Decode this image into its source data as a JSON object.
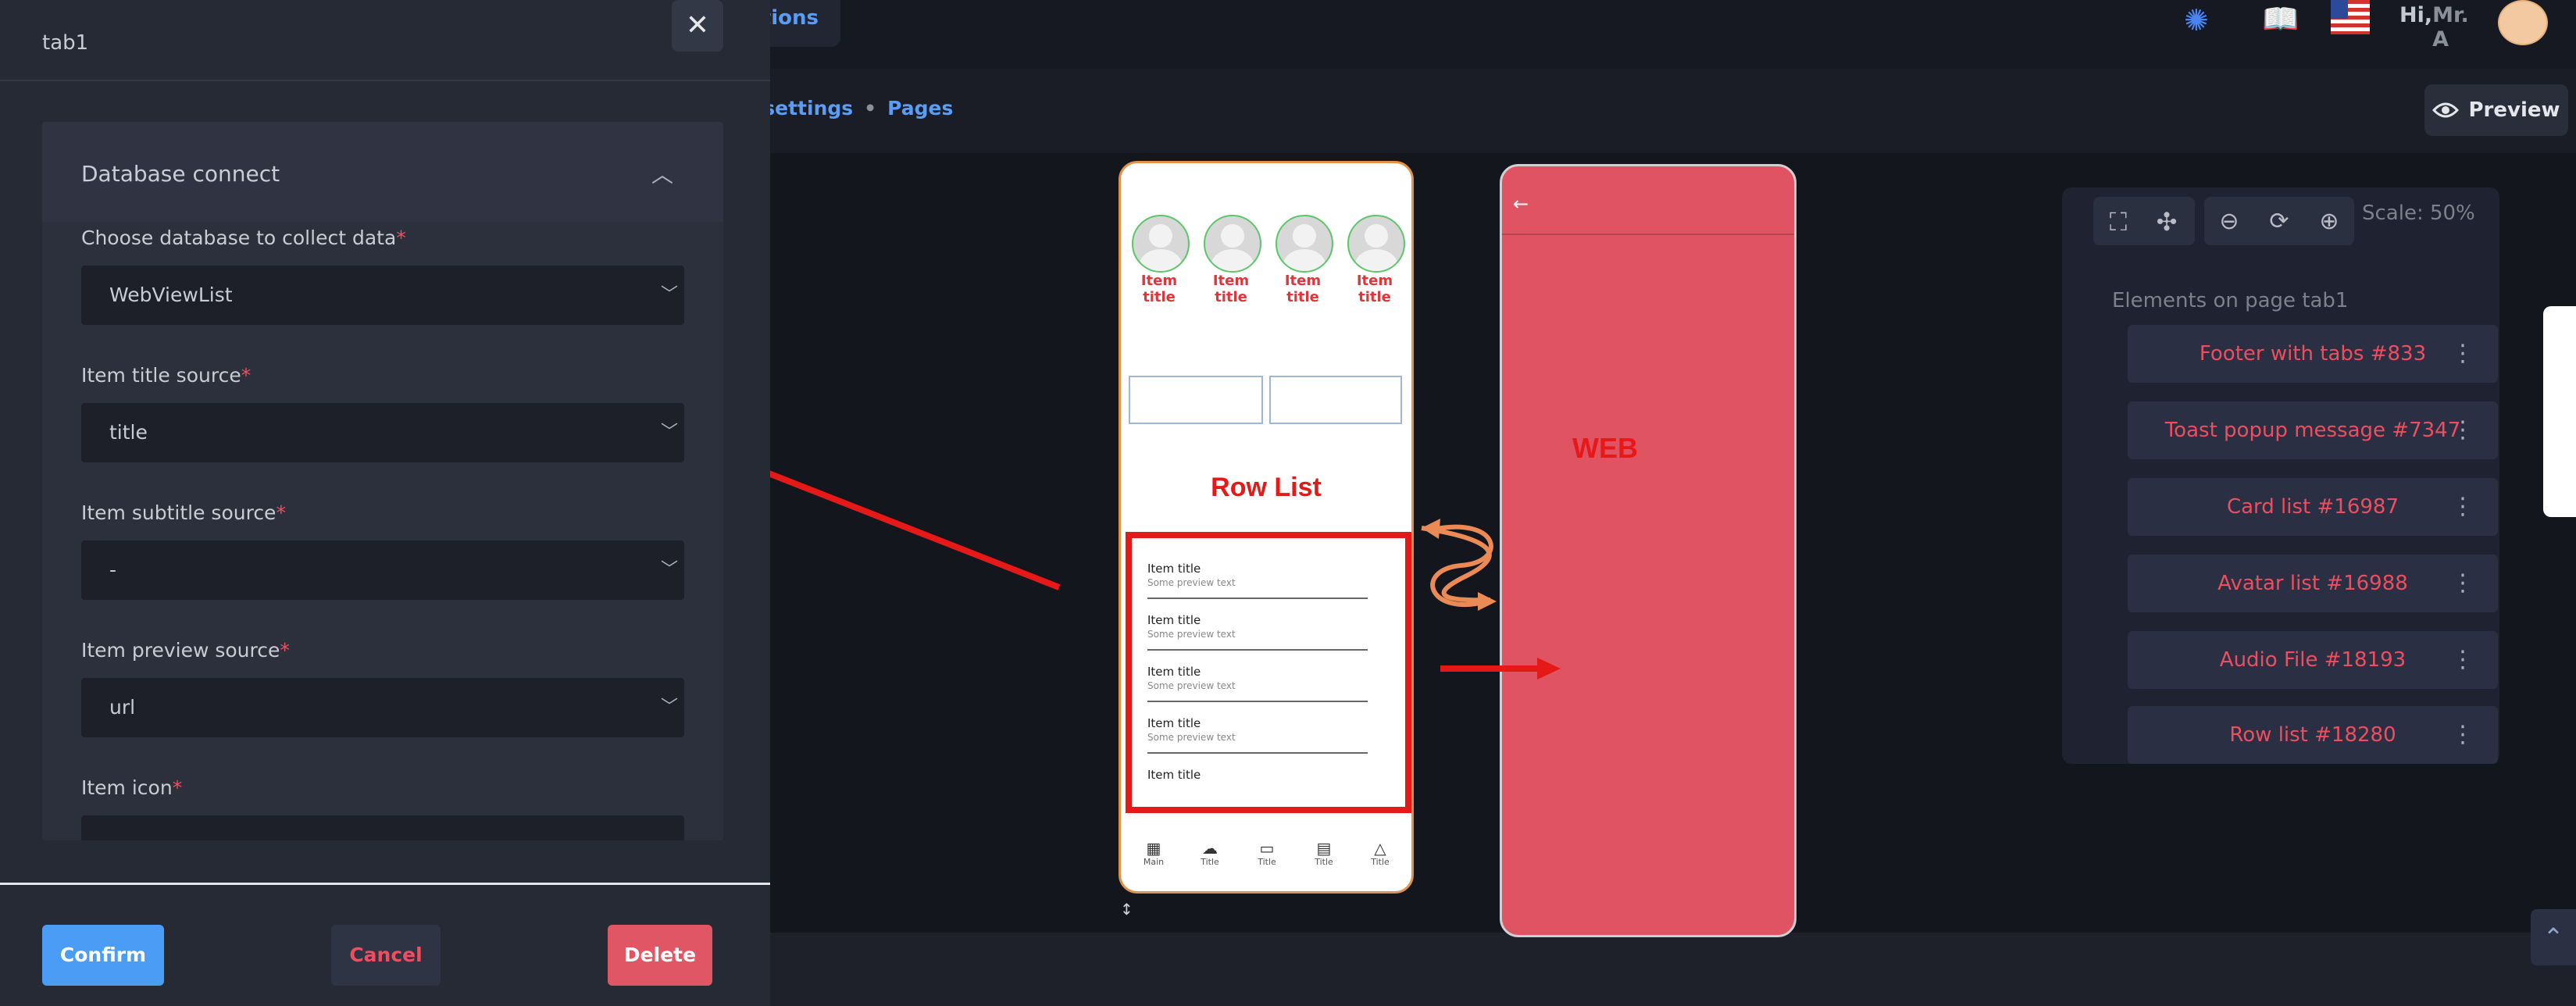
{
  "topbar": {
    "nav_fragment": "tions",
    "greeting_prefix": "Hi,",
    "greeting_name": "Mr. A"
  },
  "breadcrumb": {
    "items": [
      "l settings",
      "Pages"
    ],
    "separator": "•"
  },
  "preview_button": "Preview",
  "phone_left": {
    "avatar_titles": [
      "Item title",
      "Item title",
      "Item title",
      "Item title"
    ],
    "rowlist_label": "Row List",
    "rows": [
      {
        "title": "Item title",
        "subtitle": "Some preview text"
      },
      {
        "title": "Item title",
        "subtitle": "Some preview text"
      },
      {
        "title": "Item title",
        "subtitle": "Some preview text"
      },
      {
        "title": "Item title",
        "subtitle": "Some preview text"
      },
      {
        "title": "Item title",
        "subtitle": ""
      }
    ],
    "tabs": [
      "Main",
      "Title",
      "Title",
      "Title",
      "Title"
    ]
  },
  "phone_right": {
    "back_glyph": "←",
    "web_label": "WEB"
  },
  "elements_panel": {
    "scale": "Scale: 50%",
    "title": "Elements on page tab1",
    "items": [
      "Footer with tabs #833",
      "Toast popup message #7347",
      "Card list #16987",
      "Avatar list #16988",
      "Audio File #18193",
      "Row list #18280"
    ]
  },
  "drawer": {
    "title": "tab1",
    "section_title": "Database connect",
    "fields": [
      {
        "label": "Choose database to collect data",
        "value": "WebViewList"
      },
      {
        "label": "Item title source",
        "value": "title"
      },
      {
        "label": "Item subtitle source",
        "value": "-"
      },
      {
        "label": "Item preview source",
        "value": "url"
      },
      {
        "label": "Item icon",
        "value": ""
      }
    ],
    "required_mark": "*",
    "confirm": "Confirm",
    "cancel": "Cancel",
    "delete": "Delete"
  },
  "colors": {
    "accent_blue": "#4a9cf5",
    "danger_red": "#e15664",
    "highlight_red": "#e61919",
    "curve_orange": "#ec8a55"
  }
}
